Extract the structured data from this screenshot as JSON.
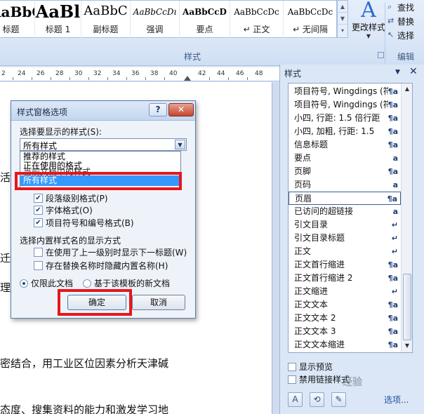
{
  "ribbon": {
    "styles": [
      {
        "sample": "AaBbC",
        "name": "标题"
      },
      {
        "sample": "AaBl",
        "name": "标题 1"
      },
      {
        "sample": "AaBbC",
        "name": "副标题"
      },
      {
        "sample": "AaBbCcDı",
        "name": "强调"
      },
      {
        "sample": "AaBbCcD",
        "name": "要点"
      },
      {
        "sample": "AaBbCcDc",
        "name": "↵ 正文"
      },
      {
        "sample": "AaBbCcDc",
        "name": "↵ 无间隔"
      }
    ],
    "change_styles": "更改样式",
    "group_label": "样式",
    "edit": {
      "find": "查找",
      "replace": "替换",
      "select": "选择",
      "group_label": "编辑"
    }
  },
  "ruler": {
    "numbers": [
      "2",
      "24",
      "26",
      "28",
      "30",
      "32",
      "34",
      "36",
      "38",
      "40",
      "42",
      "44",
      "46",
      "48"
    ]
  },
  "document": {
    "lines": [
      "活",
      "迁",
      "理",
      "密结合，用工业区位因素分析天津碱",
      "态度、搜集资料的能力和激发学习地"
    ]
  },
  "dialog": {
    "title": "样式窗格选项",
    "help": "?",
    "close": "✕",
    "select_label": "选择要显示的样式(S):",
    "select_value": "所有样式",
    "dropdown_options": [
      "推荐的样式",
      "正在使用的格式",
      "当前文档中的样式",
      "所有样式"
    ],
    "format_checks": [
      {
        "label": "段落级别格式(P)",
        "checked": true
      },
      {
        "label": "字体格式(O)",
        "checked": true
      },
      {
        "label": "项目符号和编号格式(B)",
        "checked": true
      }
    ],
    "builtin_label": "选择内置样式名的显示方式",
    "builtin_checks": [
      {
        "label": "在使用了上一级别时显示下一标题(W)",
        "checked": false
      },
      {
        "label": "存在替换名称时隐藏内置名称(H)",
        "checked": false
      }
    ],
    "radio_only": "仅限此文档",
    "radio_template": "基于该模板的新文档",
    "ok": "确定",
    "cancel": "取消"
  },
  "pane": {
    "title": "样式",
    "items": [
      {
        "name": "项目符号, Wingdings (符",
        "glyph": "¶a"
      },
      {
        "name": "项目符号, Wingdings (符",
        "glyph": "¶a"
      },
      {
        "name": "小四, 行距: 1.5 倍行距",
        "glyph": "¶a"
      },
      {
        "name": "小四, 加粗, 行距: 1.5",
        "glyph": "¶a"
      },
      {
        "name": "信息标题",
        "glyph": "¶a"
      },
      {
        "name": "要点",
        "glyph": "a"
      },
      {
        "name": "页脚",
        "glyph": "¶a"
      },
      {
        "name": "页码",
        "glyph": "a"
      },
      {
        "name": "页眉",
        "glyph": "¶a"
      },
      {
        "name": "已访问的超链接",
        "glyph": "a"
      },
      {
        "name": "引文目录",
        "glyph": "↵"
      },
      {
        "name": "引文目录标题",
        "glyph": "↵"
      },
      {
        "name": "正文",
        "glyph": "↵"
      },
      {
        "name": "正文首行缩进",
        "glyph": "¶a"
      },
      {
        "name": "正文首行缩进 2",
        "glyph": "¶a"
      },
      {
        "name": "正文缩进",
        "glyph": "↵"
      },
      {
        "name": "正文文本",
        "glyph": "¶a"
      },
      {
        "name": "正文文本 2",
        "glyph": "¶a"
      },
      {
        "name": "正文文本 3",
        "glyph": "¶a"
      },
      {
        "name": "正文文本缩进",
        "glyph": "¶a"
      }
    ],
    "show_preview": "显示预览",
    "disable_linked": "禁用链接样式",
    "options_link": "选项..."
  },
  "watermark": "经验"
}
